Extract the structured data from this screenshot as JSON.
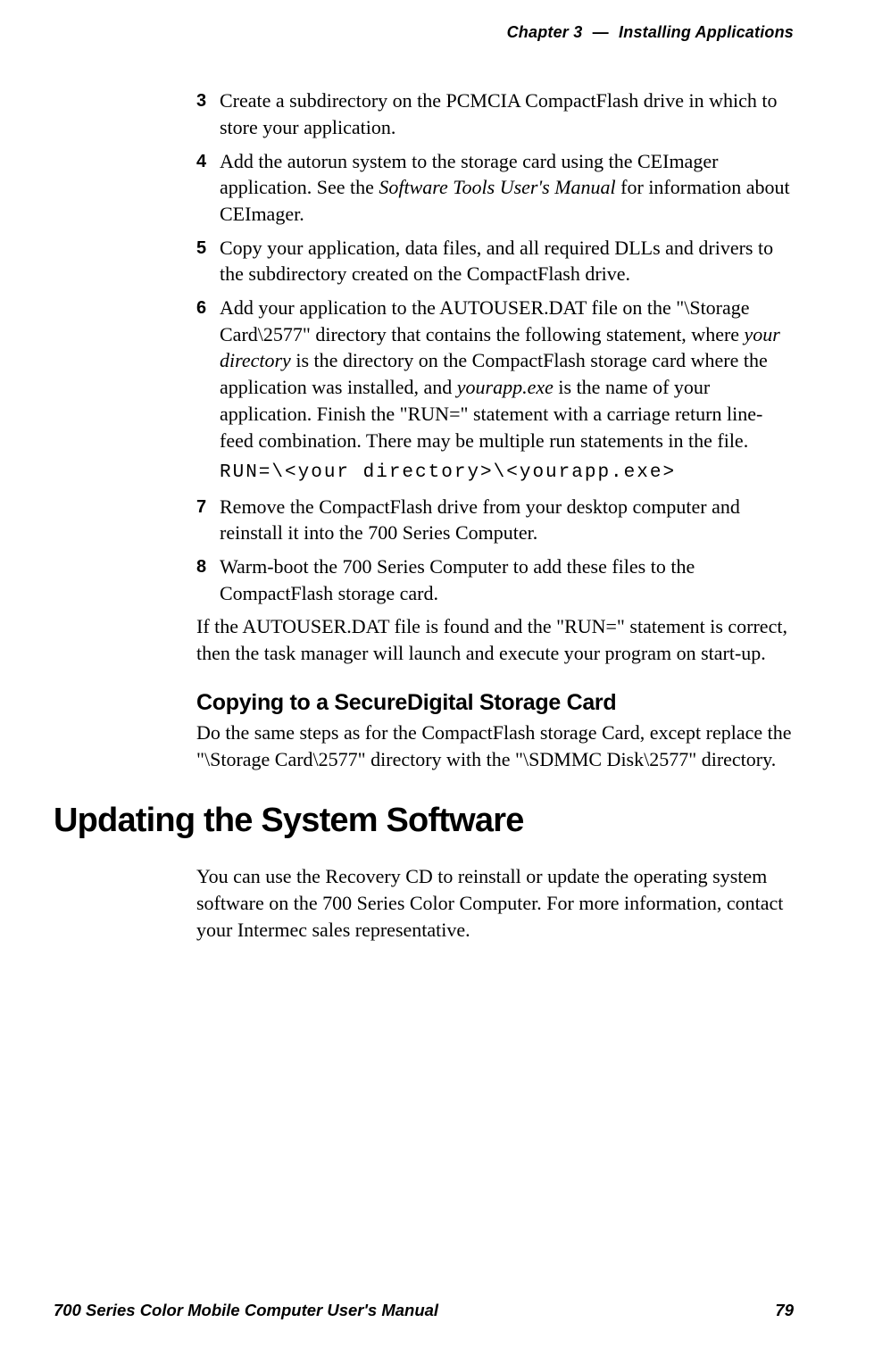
{
  "header": {
    "chapter_label": "Chapter",
    "chapter_num": "3",
    "sep": "—",
    "title": "Installing Applications"
  },
  "steps": {
    "s3": {
      "num": "3",
      "text": "Create a subdirectory on the PCMCIA CompactFlash drive in which to store your application."
    },
    "s4": {
      "num": "4",
      "pre": "Add the autorun system to the storage card using the CEImager application. See the ",
      "em": "Software Tools User's Manual",
      "post": " for information about CEImager."
    },
    "s5": {
      "num": "5",
      "text": "Copy your application, data files, and all required DLLs and drivers to the subdirectory created on the CompactFlash drive."
    },
    "s6": {
      "num": "6",
      "pre": "Add your application to the AUTOUSER.DAT file on the \"\\Storage Card\\2577\" directory that contains the following statement, where ",
      "em1": "your directory",
      "mid": " is the directory on the CompactFlash storage card where the application was installed, and ",
      "em2": "yourapp.exe",
      "post": " is the name of your application. Finish the \"RUN=\" statement with a carriage return line-feed combination. There may be multiple run statements in the file."
    },
    "code": "RUN=\\<your directory>\\<yourapp.exe>",
    "s7": {
      "num": "7",
      "text": "Remove the CompactFlash drive from your desktop computer and reinstall it into the 700 Series Computer."
    },
    "s8": {
      "num": "8",
      "text": "Warm-boot the 700 Series Computer to add these files to the CompactFlash storage card."
    }
  },
  "after_steps": "If the AUTOUSER.DAT file is found and the \"RUN=\" statement is correct, then the task manager will launch and execute your program on start-up.",
  "subhead1": "Copying to a SecureDigital Storage Card",
  "sd_para": "Do the same steps as for the CompactFlash storage Card, except replace the \"\\Storage Card\\2577\" directory with the \"\\SDMMC Disk\\2577\" directory.",
  "h1": "Updating the System Software",
  "update_para": "You can use the Recovery CD to reinstall or update the operating system software on the 700 Series Color Computer. For more information, contact your Intermec sales representative.",
  "footer": {
    "left": "700 Series Color Mobile Computer User's Manual",
    "right": "79"
  }
}
